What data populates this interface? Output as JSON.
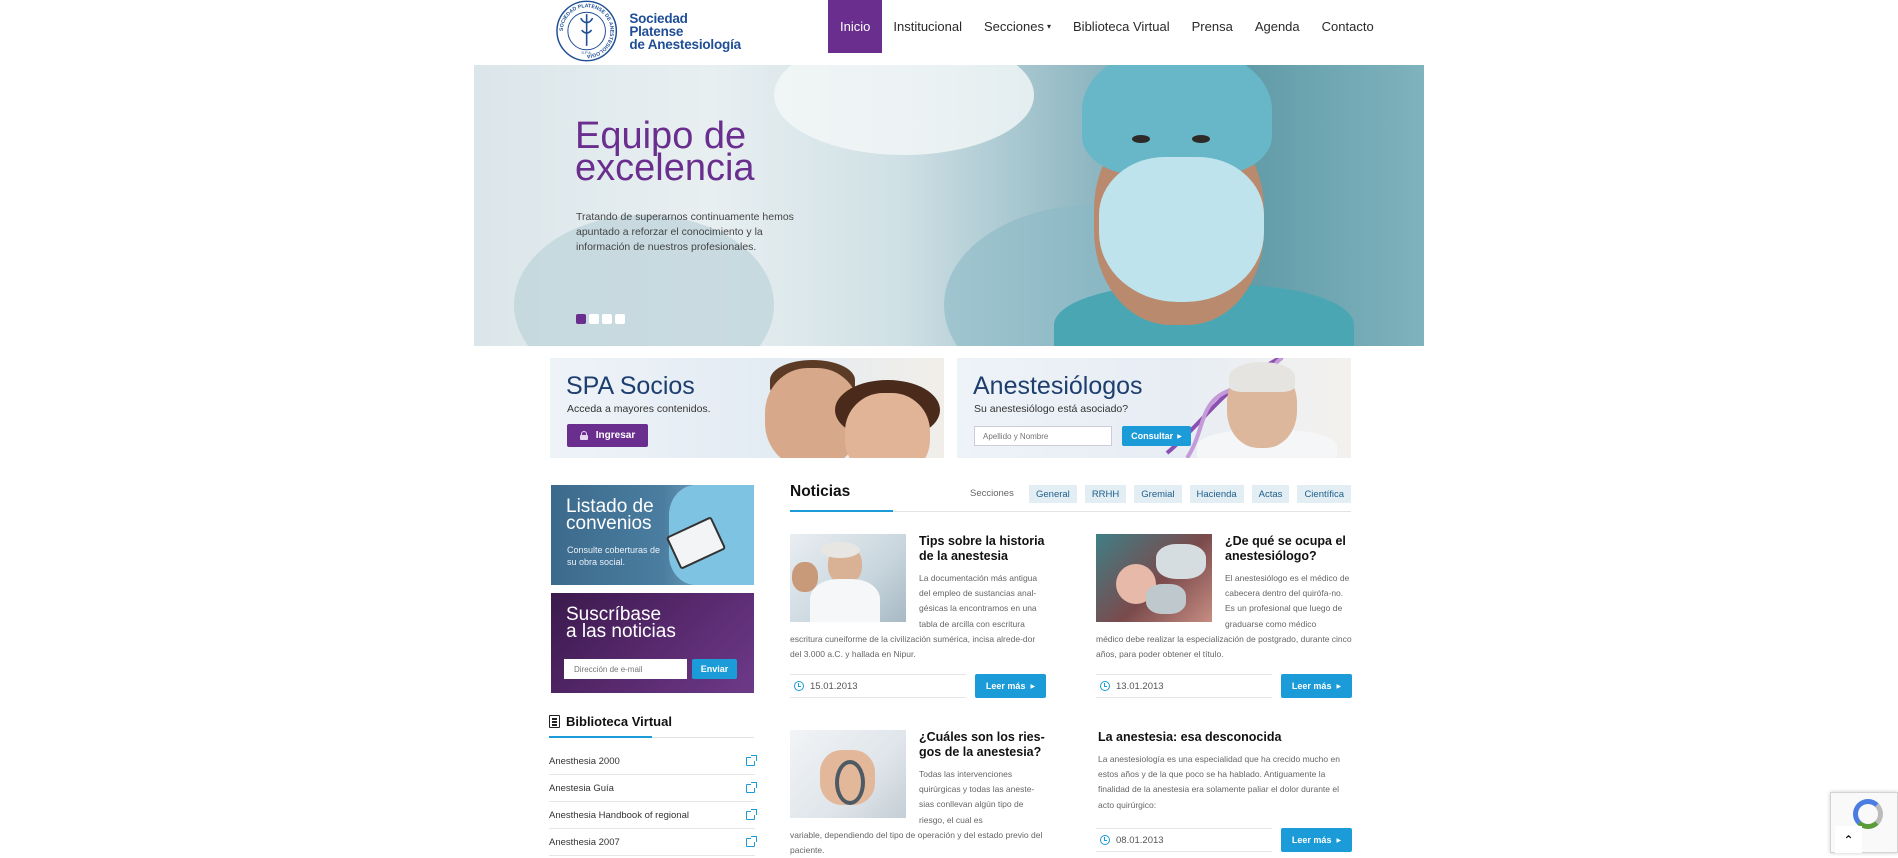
{
  "brand": {
    "name_line1": "Sociedad Platense",
    "name_line2": "de Anestesiología",
    "seal_text": "SOCIEDAD PLATENSE DE ANESTESIOLOGIA",
    "seal_initials": "S.P.A."
  },
  "nav": {
    "items": [
      {
        "label": "Inicio",
        "active": true
      },
      {
        "label": "Institucional"
      },
      {
        "label": "Secciones",
        "caret": "▾"
      },
      {
        "label": "Biblioteca Virtual"
      },
      {
        "label": "Prensa"
      },
      {
        "label": "Agenda"
      },
      {
        "label": "Contacto"
      }
    ]
  },
  "hero": {
    "title_line1": "Equipo de",
    "title_line2": "excelencia",
    "description": "Tratando de superarnos continuamente hemos apuntado a reforzar el conocimiento y la información de nuestros profesionales.",
    "active_slide": 1,
    "slide_count": 4
  },
  "promo_socios": {
    "title": "SPA Socios",
    "subtitle": "Acceda a mayores contenidos.",
    "button": "Ingresar"
  },
  "promo_anest": {
    "title": "Anestesiólogos",
    "subtitle": "Su anestesiólogo está asociado?",
    "placeholder": "Apellido y Nombre",
    "button": "Consultar"
  },
  "convenios": {
    "title_line1": "Listado de",
    "title_line2": "convenios",
    "text": "Consulte coberturas de su obra social."
  },
  "suscribase": {
    "title_line1": "Suscríbase",
    "title_line2": "a las noticias",
    "placeholder": "Dirección de e-mail",
    "button": "Enviar"
  },
  "biblioteca": {
    "title": "Biblioteca Virtual",
    "items": [
      "Anesthesia 2000",
      "Anestesia Guía",
      "Anesthesia Handbook of regional",
      "Anesthesia 2007"
    ]
  },
  "noticias": {
    "title": "Noticias",
    "filter_label": "Secciones",
    "filters": [
      "General",
      "RRHH",
      "Gremial",
      "Hacienda",
      "Actas",
      "Científica"
    ],
    "read_more": "Leer más",
    "articles": [
      {
        "title": "Tips sobre la historia de la anestesia",
        "text_side": "La documentación más antigua del empleo de sustancias anal-gésicas la encontramos en una tabla de arcilla con escritura",
        "text_full": "escritura cuneiforme de la civilización sumérica, incisa alrede-dor del 3.000 a.C. y hallada en Nipur.",
        "date": "15.01.2013"
      },
      {
        "title": "¿De qué se ocupa el anestesiólogo?",
        "text_side": "El anestesiólogo es el médico de cabecera dentro del quirófa-no. Es un profesional que luego de graduarse como médico",
        "text_full": "médico debe realizar la especialización de postgrado, durante cinco años, para poder obtener el título.",
        "date": "13.01.2013"
      },
      {
        "title": "¿Cuáles son los ries-gos de la anestesia?",
        "text_side": "Todas las intervenciones quirúrgicas y todas las aneste-sias conllevan algún tipo de riesgo, el cual es",
        "text_full": "variable, dependiendo del tipo de operación y del estado previo del paciente."
      },
      {
        "title": "La anestesia: esa desconocida",
        "text_full": "La anestesiología es una especialidad que ha crecido mucho en estos años y de la que poco se ha hablado. Antiguamente la finalidad de la anestesia era solamente paliar el dolor durante el acto quirúrgico:",
        "date": "08.01.2013"
      }
    ]
  },
  "back_to_top": "⌃",
  "colors": {
    "purple": "#6a2f8e",
    "blue": "#1b9bd7",
    "navy": "#1d3e6e"
  }
}
